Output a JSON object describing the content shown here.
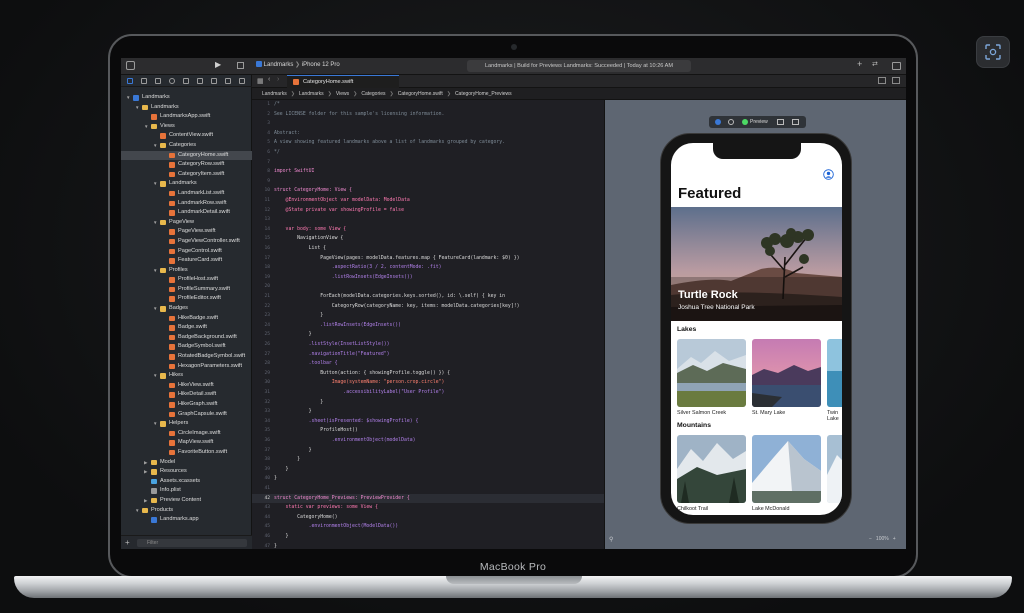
{
  "device": {
    "label": "MacBook Pro"
  },
  "toolbar": {
    "scheme_app": "Landmarks",
    "scheme_device": "iPhone 12 Pro",
    "status": "Landmarks | Build for Previews Landmarks: Succeeded | Today at 10:26 AM"
  },
  "tabbar": {
    "active_tab": "CategoryHome.swift"
  },
  "breadcrumb": [
    "Landmarks",
    "Landmarks",
    "Views",
    "Categories",
    "CategoryHome.swift",
    "CategoryHome_Previews"
  ],
  "navigator": {
    "filter_placeholder": "Filter",
    "items": [
      {
        "label": "Landmarks",
        "depth": 0,
        "kind": "project",
        "open": true
      },
      {
        "label": "Landmarks",
        "depth": 1,
        "kind": "folder",
        "open": true
      },
      {
        "label": "LandmarksApp.swift",
        "depth": 2,
        "kind": "swift"
      },
      {
        "label": "Views",
        "depth": 2,
        "kind": "folder",
        "open": true
      },
      {
        "label": "ContentView.swift",
        "depth": 3,
        "kind": "swift"
      },
      {
        "label": "Categories",
        "depth": 3,
        "kind": "folder",
        "open": true
      },
      {
        "label": "CategoryHome.swift",
        "depth": 4,
        "kind": "swift",
        "selected": true
      },
      {
        "label": "CategoryRow.swift",
        "depth": 4,
        "kind": "swift"
      },
      {
        "label": "CategoryItem.swift",
        "depth": 4,
        "kind": "swift"
      },
      {
        "label": "Landmarks",
        "depth": 3,
        "kind": "folder",
        "open": true
      },
      {
        "label": "LandmarkList.swift",
        "depth": 4,
        "kind": "swift"
      },
      {
        "label": "LandmarkRow.swift",
        "depth": 4,
        "kind": "swift"
      },
      {
        "label": "LandmarkDetail.swift",
        "depth": 4,
        "kind": "swift"
      },
      {
        "label": "PageView",
        "depth": 3,
        "kind": "folder",
        "open": true
      },
      {
        "label": "PageView.swift",
        "depth": 4,
        "kind": "swift"
      },
      {
        "label": "PageViewController.swift",
        "depth": 4,
        "kind": "swift"
      },
      {
        "label": "PageControl.swift",
        "depth": 4,
        "kind": "swift"
      },
      {
        "label": "FeatureCard.swift",
        "depth": 4,
        "kind": "swift"
      },
      {
        "label": "Profiles",
        "depth": 3,
        "kind": "folder",
        "open": true
      },
      {
        "label": "ProfileHost.swift",
        "depth": 4,
        "kind": "swift"
      },
      {
        "label": "ProfileSummary.swift",
        "depth": 4,
        "kind": "swift"
      },
      {
        "label": "ProfileEditor.swift",
        "depth": 4,
        "kind": "swift"
      },
      {
        "label": "Badges",
        "depth": 3,
        "kind": "folder",
        "open": true
      },
      {
        "label": "HikeBadge.swift",
        "depth": 4,
        "kind": "swift"
      },
      {
        "label": "Badge.swift",
        "depth": 4,
        "kind": "swift"
      },
      {
        "label": "BadgeBackground.swift",
        "depth": 4,
        "kind": "swift"
      },
      {
        "label": "BadgeSymbol.swift",
        "depth": 4,
        "kind": "swift"
      },
      {
        "label": "RotatedBadgeSymbol.swift",
        "depth": 4,
        "kind": "swift"
      },
      {
        "label": "HexagonParameters.swift",
        "depth": 4,
        "kind": "swift"
      },
      {
        "label": "Hikes",
        "depth": 3,
        "kind": "folder",
        "open": true
      },
      {
        "label": "HikeView.swift",
        "depth": 4,
        "kind": "swift"
      },
      {
        "label": "HikeDetail.swift",
        "depth": 4,
        "kind": "swift"
      },
      {
        "label": "HikeGraph.swift",
        "depth": 4,
        "kind": "swift"
      },
      {
        "label": "GraphCapsule.swift",
        "depth": 4,
        "kind": "swift"
      },
      {
        "label": "Helpers",
        "depth": 3,
        "kind": "folder",
        "open": true
      },
      {
        "label": "CircleImage.swift",
        "depth": 4,
        "kind": "swift"
      },
      {
        "label": "MapView.swift",
        "depth": 4,
        "kind": "swift"
      },
      {
        "label": "FavoriteButton.swift",
        "depth": 4,
        "kind": "swift"
      },
      {
        "label": "Model",
        "depth": 2,
        "kind": "folder",
        "open": false
      },
      {
        "label": "Resources",
        "depth": 2,
        "kind": "folder",
        "open": false
      },
      {
        "label": "Assets.xcassets",
        "depth": 2,
        "kind": "assets"
      },
      {
        "label": "Info.plist",
        "depth": 2,
        "kind": "plist"
      },
      {
        "label": "Preview Content",
        "depth": 2,
        "kind": "folder",
        "open": false
      },
      {
        "label": "Products",
        "depth": 1,
        "kind": "folder",
        "open": true
      },
      {
        "label": "Landmarks.app",
        "depth": 2,
        "kind": "app"
      }
    ]
  },
  "editor": {
    "lines": [
      "/*",
      "See LICENSE folder for this sample's licensing information.",
      "",
      "Abstract:",
      "A view showing featured landmarks above a list of landmarks grouped by category.",
      "*/",
      "",
      "import SwiftUI",
      "",
      "struct CategoryHome: View {",
      "    @EnvironmentObject var modelData: ModelData",
      "    @State private var showingProfile = false",
      "",
      "    var body: some View {",
      "        NavigationView {",
      "            List {",
      "                PageView(pages: modelData.features.map { FeatureCard(landmark: $0) })",
      "                    .aspectRatio(3 / 2, contentMode: .fit)",
      "                    .listRowInsets(EdgeInsets())",
      "",
      "                ForEach(modelData.categories.keys.sorted(), id: \\.self) { key in",
      "                    CategoryRow(categoryName: key, items: modelData.categories[key]!)",
      "                }",
      "                .listRowInsets(EdgeInsets())",
      "            }",
      "            .listStyle(InsetListStyle())",
      "            .navigationTitle(\"Featured\")",
      "            .toolbar {",
      "                Button(action: { showingProfile.toggle() }) {",
      "                    Image(systemName: \"person.crop.circle\")",
      "                        .accessibilityLabel(\"User Profile\")",
      "                }",
      "            }",
      "            .sheet(isPresented: $showingProfile) {",
      "                ProfileHost()",
      "                    .environmentObject(modelData)",
      "            }",
      "        }",
      "    }",
      "}",
      "",
      "struct CategoryHome_Previews: PreviewProvider {",
      "    static var previews: some View {",
      "        CategoryHome()",
      "            .environmentObject(ModelData())",
      "    }",
      "}"
    ],
    "highlighted_line": 42
  },
  "preview": {
    "badge": "Preview",
    "zoom": "100%",
    "nav_title": "Featured",
    "hero_title": "Turtle Rock",
    "hero_subtitle": "Joshua Tree National Park",
    "sections": [
      {
        "title": "Lakes",
        "items": [
          "Silver Salmon Creek",
          "St. Mary Lake",
          "Twin Lake"
        ]
      },
      {
        "title": "Mountains",
        "items": [
          "Chilkoot Trail",
          "Lake McDonald",
          ""
        ]
      }
    ]
  },
  "colors": {
    "accent": "#3a78d6",
    "swift_icon": "#e7733a",
    "folder": "#e8b84c",
    "preview_live": "#4cd964"
  }
}
